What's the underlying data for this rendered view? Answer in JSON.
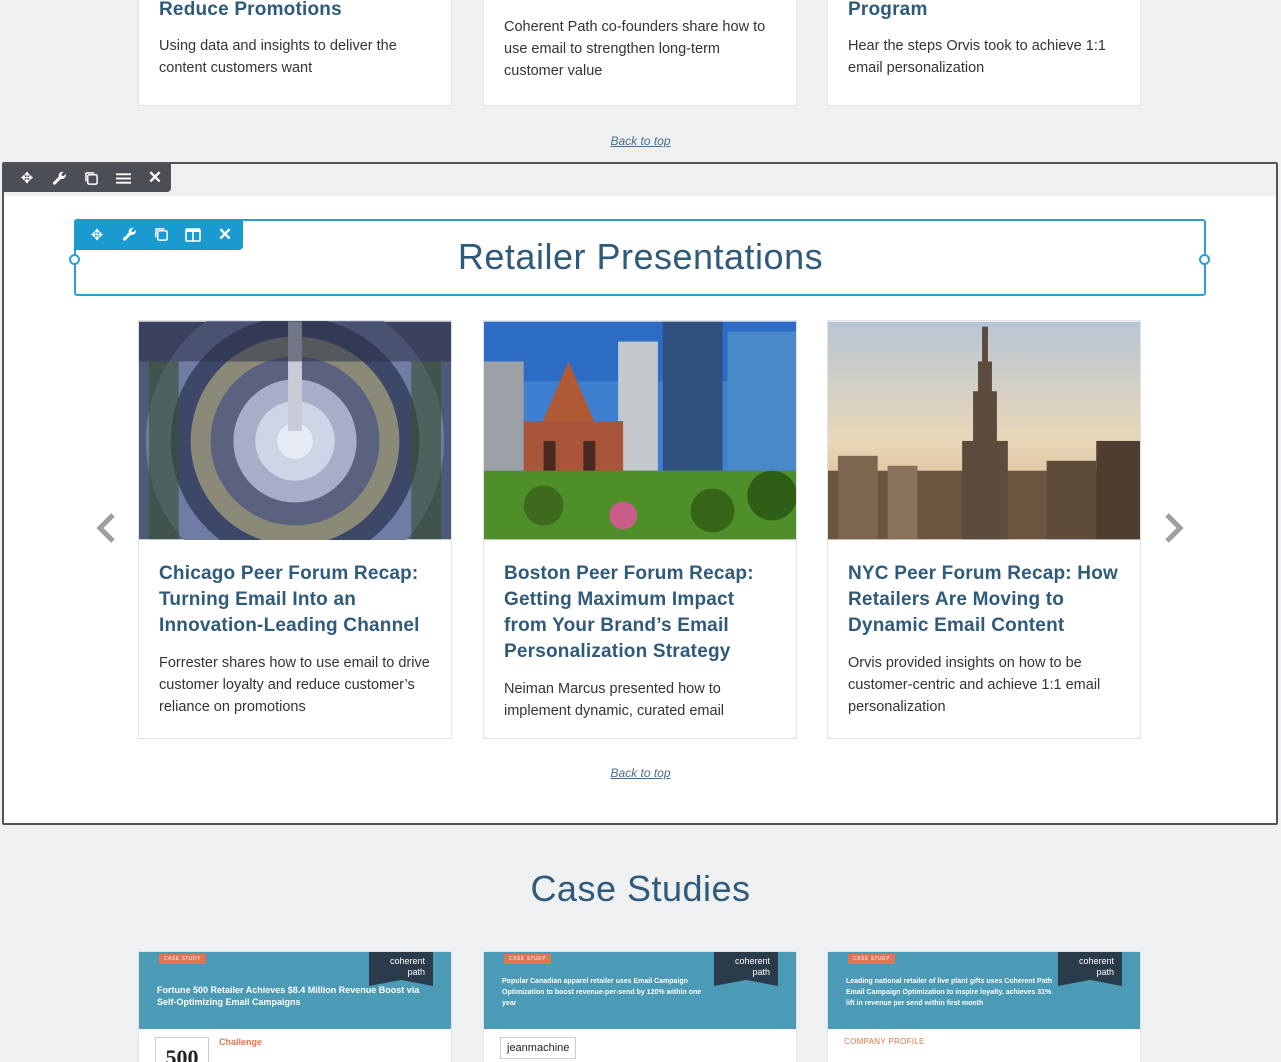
{
  "top_cards": [
    {
      "title": "Reduce Promotions",
      "desc": "Using data and insights to deliver the content customers want"
    },
    {
      "title": "",
      "desc": "Coherent Path co-founders share how to use email to strengthen long-term customer value"
    },
    {
      "title": "Program",
      "desc": "Hear the steps Orvis took to achieve 1:1 email personalization"
    }
  ],
  "back_to_top": "Back to top",
  "retailer": {
    "heading": "Retailer Presentations",
    "cards": [
      {
        "title": "Chicago Peer Forum Recap: Turning Email Into an Innovation-Leading Channel",
        "desc": "Forrester shares how to use email to drive customer loyalty and reduce customer’s reliance on promotions"
      },
      {
        "title": "Boston Peer Forum Recap: Getting Maximum Impact from Your Brand’s Email Personalization Strategy",
        "desc": "Neiman Marcus presented how to implement dynamic, curated email"
      },
      {
        "title": "NYC Peer Forum Recap: How Retailers Are Moving to Dynamic Email Content",
        "desc": "Orvis provided insights on how to be customer-centric and achieve 1:1 email personalization"
      }
    ]
  },
  "case_studies": {
    "heading": "Case Studies",
    "cards": [
      {
        "tag": "CASE STUDY",
        "logo_line1": "coherent",
        "logo_line2": "path",
        "headline": "Fortune 500 Retailer Achieves $8.4 Million Revenue Boost via Self-Optimizing Email Campaigns",
        "lower_label": "Challenge"
      },
      {
        "tag": "CASE STUDY",
        "logo_line1": "coherent",
        "logo_line2": "path",
        "headline": "Popular Canadian apparel retailer uses Email Campaign Optimization to boost revenue-per-send by 120% within one year",
        "lower_label": "jeanmachine"
      },
      {
        "tag": "CASE STUDY",
        "logo_line1": "coherent",
        "logo_line2": "path",
        "headline": "Leading national retailer of live plant gifts uses Coherent Path Email Campaign Optimization to inspire loyalty, achieves 31% lift in revenue per send within first month",
        "lower_label": "COMPANY PROFILE"
      }
    ]
  },
  "icons": {
    "move": "move-icon",
    "settings": "wrench-icon",
    "duplicate": "duplicate-icon",
    "menu": "menu-icon",
    "columns": "columns-icon",
    "close": "close-icon",
    "prev": "chevron-left-icon",
    "next": "chevron-right-icon"
  },
  "colors": {
    "heading": "#2f5a7a",
    "module_outline": "#2ba0cc",
    "row_toolbar": "#4b4e55",
    "banner": "#4b9ab6",
    "tag": "#e0764d"
  }
}
